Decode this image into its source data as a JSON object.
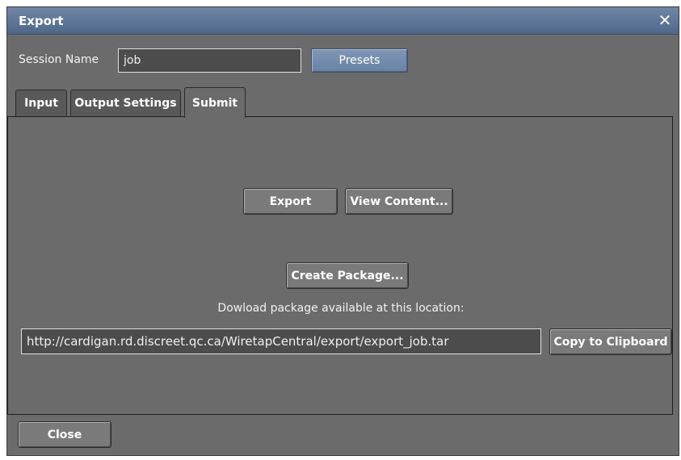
{
  "window": {
    "title": "Export",
    "close_glyph": "✕"
  },
  "session": {
    "label": "Session Name",
    "value": "job",
    "presets_label": "Presets"
  },
  "tabs": [
    {
      "label": "Input"
    },
    {
      "label": "Output Settings"
    },
    {
      "label": "Submit",
      "active": true
    }
  ],
  "submit": {
    "export_label": "Export",
    "view_content_label": "View Content...",
    "create_package_label": "Create Package...",
    "download_text": "Dowload package available at this location:",
    "url_value": "http://cardigan.rd.discreet.qc.ca/WiretapCentral/export/export_job.tar",
    "copy_label": "Copy to Clipboard"
  },
  "footer": {
    "close_label": "Close"
  },
  "colors": {
    "titlebar": "#5c7497",
    "body": "#6b6b6b",
    "accent_button": "#7489aa"
  }
}
